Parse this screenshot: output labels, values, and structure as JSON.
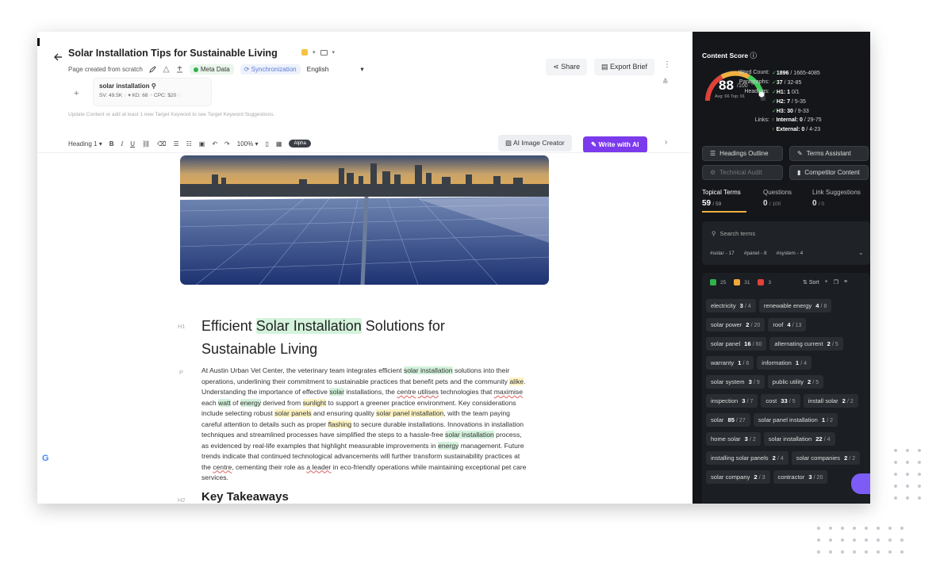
{
  "header": {
    "title": "Solar Installation Tips for Sustainable Living",
    "subtitle": "Page created from scratch",
    "meta_badge": "Meta Data",
    "sync_badge": "Synchronization",
    "language": "English",
    "share_label": "Share",
    "export_label": "Export Brief"
  },
  "keyword": {
    "name": "solar installation",
    "sv": "SV: 49.5K",
    "kd": "KD: 68",
    "cpc": "CPC: $20",
    "hint": "Update Content or add at least 1 new Target Keyword to see Target Keyword Suggestions."
  },
  "toolbar": {
    "heading": "Heading 1",
    "zoom": "100%",
    "alpha": "Alpha",
    "ai_image": "AI Image Creator",
    "write_ai": "Write with AI"
  },
  "doc": {
    "h1_marker": "H1",
    "h1_pre": "Efficient ",
    "h1_hl": "Solar Installation",
    "h1_post": " Solutions for Sustainable Living",
    "p_marker": "P",
    "p1": "At Austin Urban Vet Center, the veterinary team integrates efficient ",
    "k1": "solar installation",
    "p2": " solutions into their operations, underlining their commitment to sustainable practices that benefit pets and the community ",
    "k2": "alike",
    "p3": ". Understanding the importance of effective ",
    "k3": "solar",
    "p4": " installations, the ",
    "k4": "centre",
    "p5": " ",
    "k5": "utilises",
    "p6": " technologies that ",
    "k6": "maximise",
    "p7": " each ",
    "k7": "watt",
    "p8": " of ",
    "k8": "energy",
    "p9": " derived from ",
    "k9": "sunlight",
    "p10": " to support a greener practice environment. Key considerations include selecting robust ",
    "k10": "solar panels",
    "p11": " and ensuring quality ",
    "k11": "solar panel installation",
    "p12": ", with the team paying careful attention to details such as proper ",
    "k12": "flashing",
    "p13": " to secure durable installations. Innovations in installation techniques and streamlined processes have simplified the steps to a hassle-free ",
    "k13": "solar installation",
    "p14": " process, as evidenced by real-life examples that highlight measurable improvements in ",
    "k14": "energy",
    "p15": " management. Future trends indicate that continued technological advancements will further transform sustainability practices at the ",
    "k15": "centre",
    "p16": ", cementing their role as ",
    "k16": "a leader",
    "p17": " in eco-friendly operations while maintaining exceptional pet care services.",
    "h2_marker": "H2",
    "h2": "Key Takeaways"
  },
  "score": {
    "label": "Content Score",
    "value": "88",
    "max": "/100",
    "avg": "Avg: 66 Top: 91",
    "word_count_label": "Word Count:",
    "word_count": "1896",
    "word_count_range": "/ 1665-4085",
    "paragraphs_label": "Paragraphs:",
    "paragraphs": "37",
    "paragraphs_range": "/ 32-85",
    "headings_label": "Headings:",
    "h1": "H1: 1",
    "h1_range": "0/1",
    "h2": "H2: 7",
    "h2_range": "/ 5-35",
    "h3": "H3: 30",
    "h3_range": "/ 9-33",
    "links_label": "Links:",
    "internal": "Internal: 0",
    "internal_range": "/ 29-75",
    "external": "External: 0",
    "external_range": "/ 4-23",
    "score_fraction": 0.88
  },
  "panel": {
    "headings_outline": "Headings Outline",
    "terms_assistant": "Terms Assistant",
    "technical_audit": "Technical Audit",
    "competitor_content": "Competitor Content",
    "tabs": [
      {
        "label": "Topical Terms",
        "count": "59",
        "total": "/ 59"
      },
      {
        "label": "Questions",
        "count": "0",
        "total": "/ 100"
      },
      {
        "label": "Link Suggestions",
        "count": "0",
        "total": "/ 0"
      }
    ],
    "search_placeholder": "Search terms",
    "tags": [
      "#solar - 17",
      "#panel - 8",
      "#system - 4"
    ],
    "filter_green": "25",
    "filter_yellow": "31",
    "filter_red": "3",
    "sort": "Sort"
  },
  "terms": [
    {
      "t": "electricity",
      "c": "3",
      "r": "/ 4"
    },
    {
      "t": "renewable energy",
      "c": "4",
      "r": "/ 8"
    },
    {
      "t": "solar power",
      "c": "2",
      "r": "/ 20"
    },
    {
      "t": "roof",
      "c": "4",
      "r": "/ 13"
    },
    {
      "t": "solar panel",
      "c": "16",
      "r": "/ 60"
    },
    {
      "t": "alternating current",
      "c": "2",
      "r": "/ 5"
    },
    {
      "t": "warranty",
      "c": "1",
      "r": "/ 6"
    },
    {
      "t": "information",
      "c": "1",
      "r": "/ 4"
    },
    {
      "t": "solar system",
      "c": "3",
      "r": "/ 9"
    },
    {
      "t": "public utility",
      "c": "2",
      "r": "/ 5"
    },
    {
      "t": "inspection",
      "c": "3",
      "r": "/ 7"
    },
    {
      "t": "cost",
      "c": "33",
      "r": "/ 5"
    },
    {
      "t": "install solar",
      "c": "2",
      "r": "/ 2"
    },
    {
      "t": "solar",
      "c": "85",
      "r": "/ 27"
    },
    {
      "t": "solar panel installation",
      "c": "1",
      "r": "/ 2"
    },
    {
      "t": "home solar",
      "c": "3",
      "r": "/ 2"
    },
    {
      "t": "solar installation",
      "c": "22",
      "r": "/ 4"
    },
    {
      "t": "installing solar panels",
      "c": "2",
      "r": "/ 4"
    },
    {
      "t": "solar companies",
      "c": "2",
      "r": "/ 2"
    },
    {
      "t": "solar company",
      "c": "2",
      "r": "/ 3"
    },
    {
      "t": "contractor",
      "c": "3",
      "r": "/ 20"
    }
  ],
  "colors": {
    "accent_purple": "#7c3aed",
    "highlight_green": "#d4f2dc",
    "panel_bg": "#141619",
    "gauge_green": "#3ecf5a",
    "gauge_red": "#e0413a"
  }
}
